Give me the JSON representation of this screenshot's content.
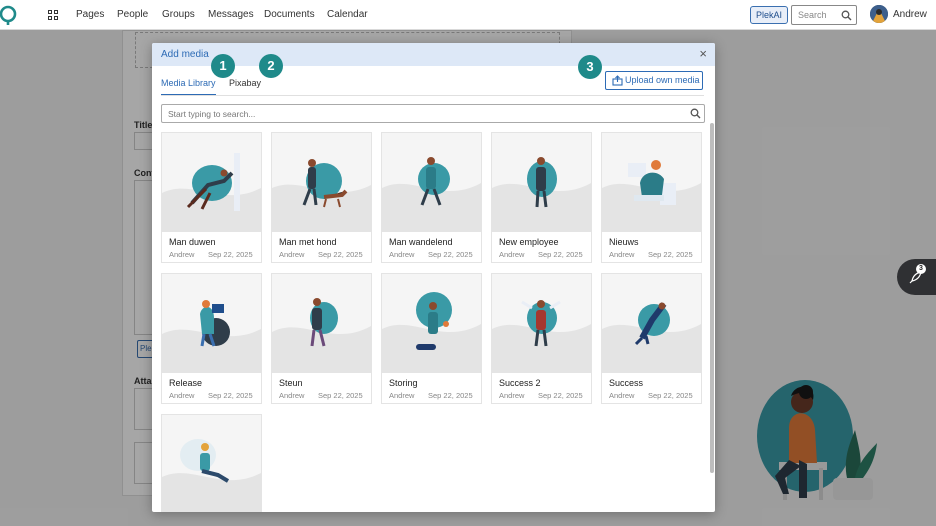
{
  "nav": {
    "items": [
      "Pages",
      "People",
      "Groups",
      "Messages",
      "Documents",
      "Calendar"
    ],
    "plekai_label": "PlekAI",
    "search_placeholder": "Search",
    "user_name": "Andrew"
  },
  "background_page": {
    "title_label": "Title",
    "content_label": "Cont",
    "attachments_label": "Atta",
    "button_label": "Ple"
  },
  "modal": {
    "title": "Add media",
    "tabs": [
      {
        "label": "Media Library",
        "active": true
      },
      {
        "label": "Pixabay",
        "active": false
      }
    ],
    "upload_label": "Upload own media",
    "search_placeholder": "Start typing to search...",
    "items": [
      {
        "title": "Man duwen",
        "author": "Andrew",
        "date": "Sep 22, 2025"
      },
      {
        "title": "Man met hond",
        "author": "Andrew",
        "date": "Sep 22, 2025"
      },
      {
        "title": "Man wandelend",
        "author": "Andrew",
        "date": "Sep 22, 2025"
      },
      {
        "title": "New employee",
        "author": "Andrew",
        "date": "Sep 22, 2025"
      },
      {
        "title": "Nieuws",
        "author": "Andrew",
        "date": "Sep 22, 2025"
      },
      {
        "title": "Release",
        "author": "Andrew",
        "date": "Sep 22, 2025"
      },
      {
        "title": "Steun",
        "author": "Andrew",
        "date": "Sep 22, 2025"
      },
      {
        "title": "Storing",
        "author": "Andrew",
        "date": "Sep 22, 2025"
      },
      {
        "title": "Success 2",
        "author": "Andrew",
        "date": "Sep 22, 2025"
      },
      {
        "title": "Success",
        "author": "Andrew",
        "date": "Sep 22, 2025"
      },
      {
        "title": "",
        "author": "",
        "date": ""
      }
    ]
  },
  "markers": [
    "1",
    "2",
    "3"
  ],
  "rocket_badge": "3",
  "colors": {
    "accent": "#2d6bb5",
    "teal": "#3a9aa6",
    "marker": "#1f8a8a"
  }
}
